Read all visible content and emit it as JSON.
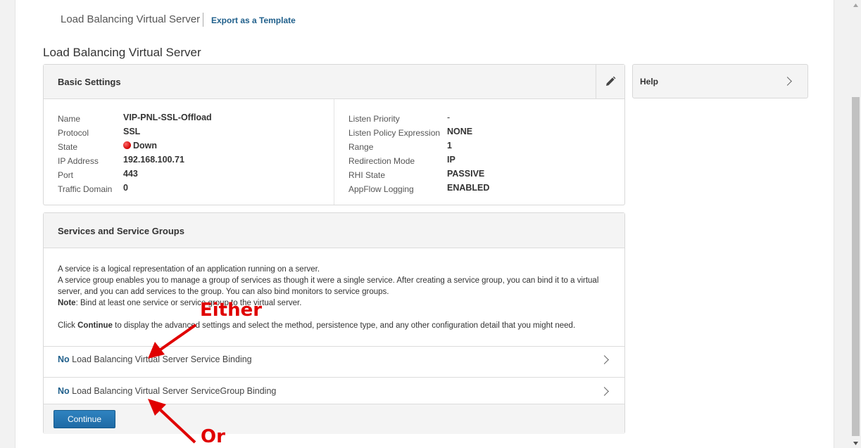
{
  "breadcrumb": {
    "title": "Load Balancing Virtual Server",
    "export_link": "Export as a Template"
  },
  "page_title": "Load Balancing Virtual Server",
  "basic_settings": {
    "title": "Basic Settings",
    "left": [
      {
        "label": "Name",
        "value": "VIP-PNL-SSL-Offload"
      },
      {
        "label": "Protocol",
        "value": "SSL"
      },
      {
        "label": "State",
        "value": "Down"
      },
      {
        "label": "IP Address",
        "value": "192.168.100.71"
      },
      {
        "label": "Port",
        "value": "443"
      },
      {
        "label": "Traffic Domain",
        "value": "0"
      }
    ],
    "right": [
      {
        "label": "Listen Priority",
        "value": "-"
      },
      {
        "label": "Listen Policy Expression",
        "value": "NONE"
      },
      {
        "label": "Range",
        "value": "1"
      },
      {
        "label": "Redirection Mode",
        "value": "IP"
      },
      {
        "label": "RHI State",
        "value": "PASSIVE"
      },
      {
        "label": "AppFlow Logging",
        "value": "ENABLED"
      }
    ]
  },
  "help": {
    "title": "Help"
  },
  "services": {
    "title": "Services and Service Groups",
    "desc_line1": "A service is a logical representation of an application running on a server.",
    "desc_line2": "A service group enables you to manage a group of services as though it were a single service. After creating a service group, you can bind it to a virtual server, and you can add services to the group. You can also bind monitors to service groups.",
    "note_label": "Note",
    "note_text": ": Bind at least one service or service group to the virtual server.",
    "click_pre": "Click ",
    "click_bold": "Continue",
    "click_post": " to display the advanced settings and select the method, persistence type, and any other configuration detail that you might need.",
    "bindings": [
      {
        "count": "No",
        "label": " Load Balancing Virtual Server Service Binding"
      },
      {
        "count": "No",
        "label": " Load Balancing Virtual Server ServiceGroup Binding"
      }
    ],
    "continue_label": "Continue"
  },
  "annotations": {
    "either": "Either",
    "or": "Or",
    "color": "#e00000"
  },
  "colors": {
    "link": "#1f5f8b",
    "button": "#2577b5",
    "state_down": "#d00000"
  }
}
